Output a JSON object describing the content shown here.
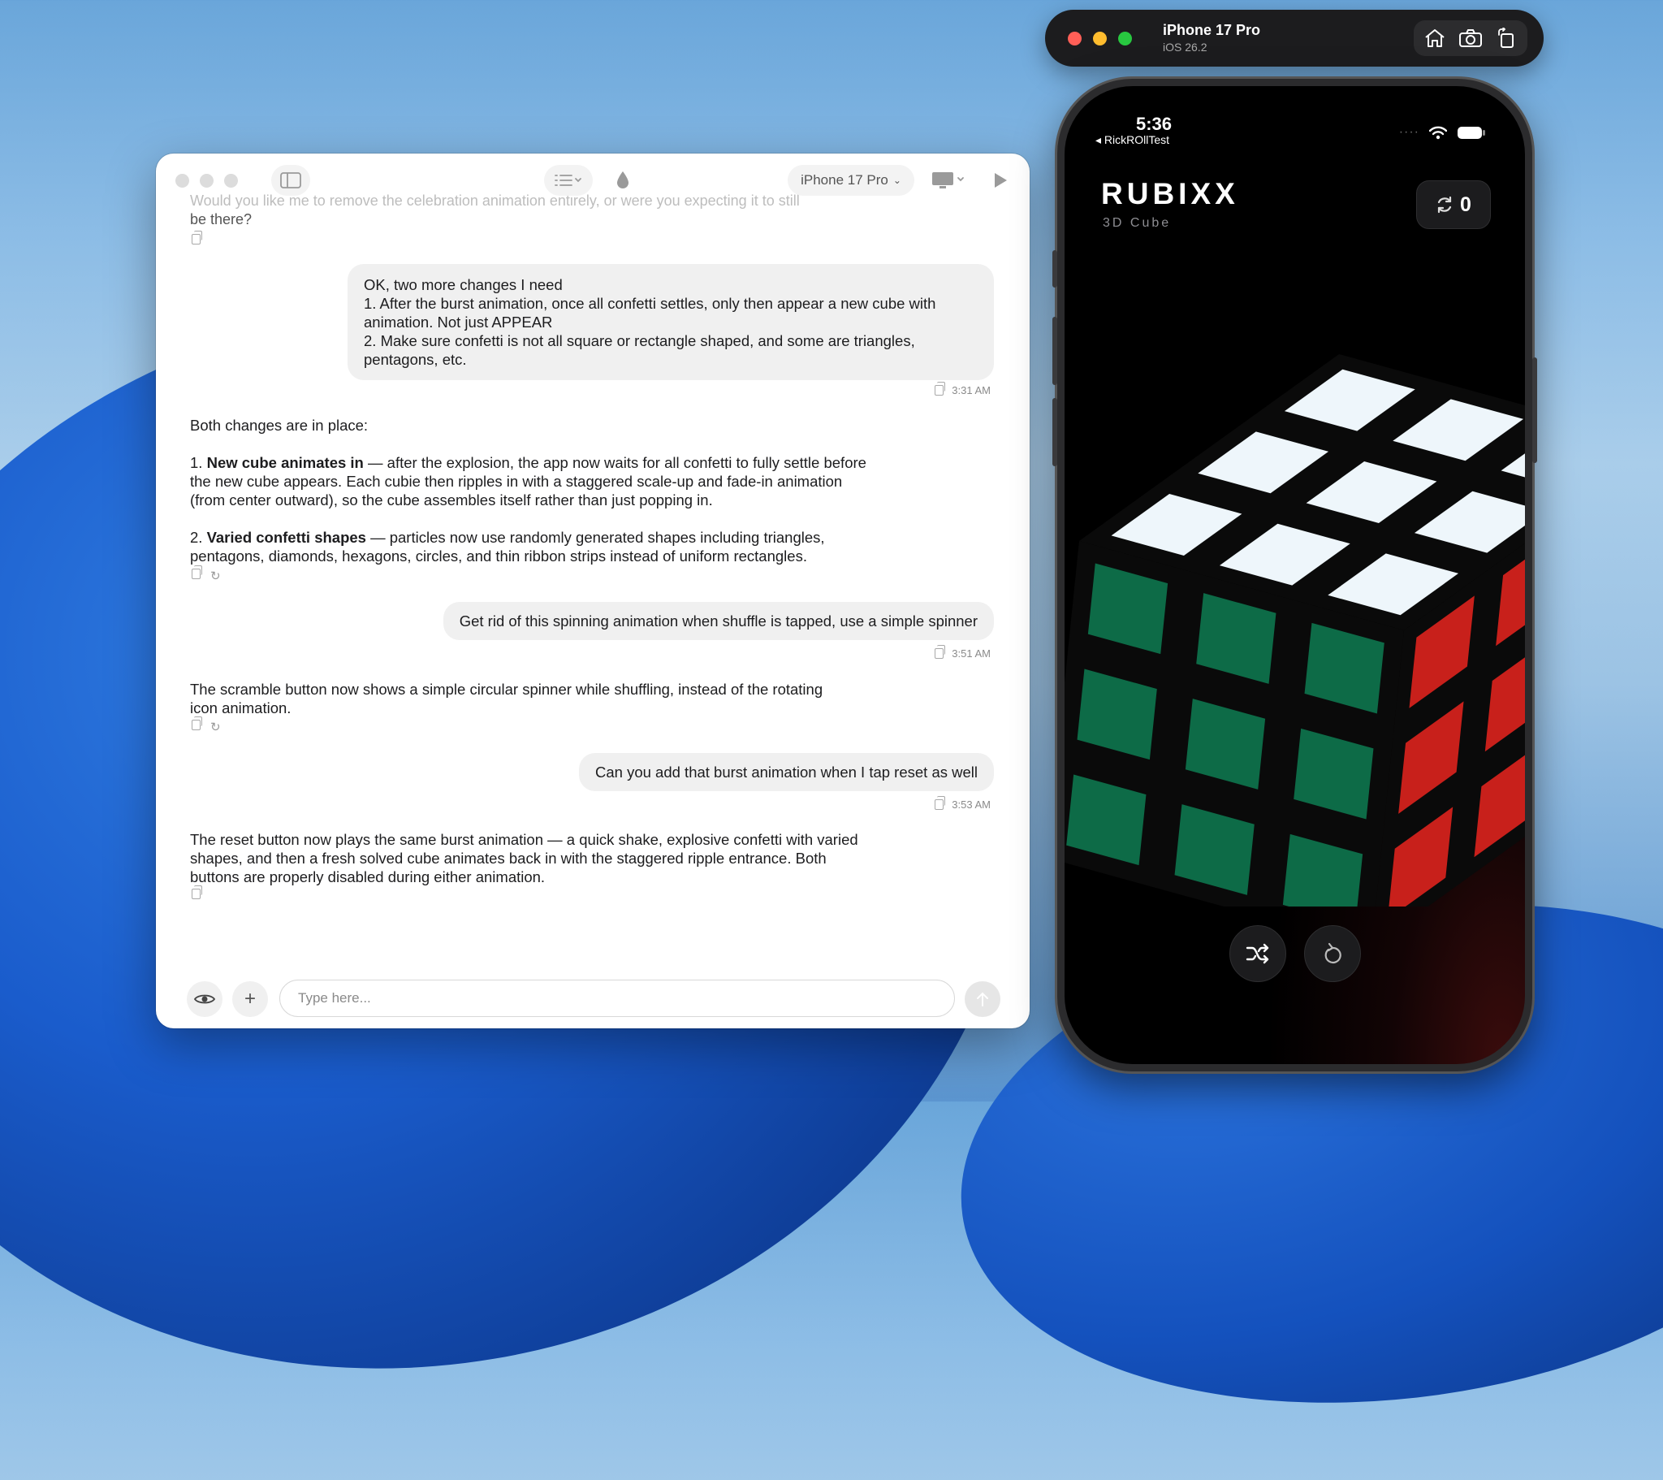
{
  "chat": {
    "toolbar": {
      "device": "iPhone 17 Pro"
    },
    "faded_line1": "Would you like me to remove the celebration animation entirely, or were you expecting it to still",
    "faded_line2": "be there?",
    "messages": [
      {
        "role": "user",
        "lines": [
          "OK, two more changes I need",
          "1. After the burst animation, once all confetti settles, only then appear a new cube with",
          "animation. Not just APPEAR",
          "2. Make sure confetti is not all square or rectangle shaped, and some are triangles,",
          "pentagons, etc."
        ],
        "time": "3:31 AM"
      },
      {
        "role": "assistant",
        "intro": "Both changes are in place:",
        "item1_title": "New cube animates in",
        "item1_lines": [
          " — after the explosion, the app now waits for all confetti to fully settle before",
          "the new cube appears. Each cubie then ripples in with a staggered scale-up and fade-in animation",
          "(from center outward), so the cube assembles itself rather than just popping in."
        ],
        "item2_title": "Varied confetti shapes",
        "item2_lines": [
          " — particles now use randomly generated shapes including triangles,",
          "pentagons, diamonds, hexagons, circles, and thin ribbon strips instead of uniform rectangles."
        ]
      },
      {
        "role": "user",
        "text": "Get rid of this spinning animation when shuffle is tapped, use a simple spinner",
        "time": "3:51 AM"
      },
      {
        "role": "assistant",
        "lines": [
          "The scramble button now shows a simple circular spinner while shuffling, instead of the rotating",
          "icon animation."
        ]
      },
      {
        "role": "user",
        "text": "Can you add that burst animation when I tap reset as well",
        "time": "3:53 AM"
      },
      {
        "role": "assistant",
        "lines": [
          "The reset button now plays the same burst animation — a quick shake, explosive confetti with varied",
          "shapes, and then a fresh solved cube animates back in with the staggered ripple entrance. Both",
          "buttons are properly disabled during either animation."
        ]
      }
    ],
    "composer": {
      "placeholder": "Type here..."
    }
  },
  "simulator": {
    "device_name": "iPhone 17 Pro",
    "os_version": "iOS 26.2",
    "status_time": "5:36",
    "back_app": "RickROllTest",
    "app_title": "RUBIXX",
    "app_subtitle": "3D Cube",
    "move_count": "0",
    "colors": {
      "white": "#eef6fb",
      "red": "#c8201b",
      "green": "#0d6b47",
      "body": "#0a0a0a"
    }
  }
}
